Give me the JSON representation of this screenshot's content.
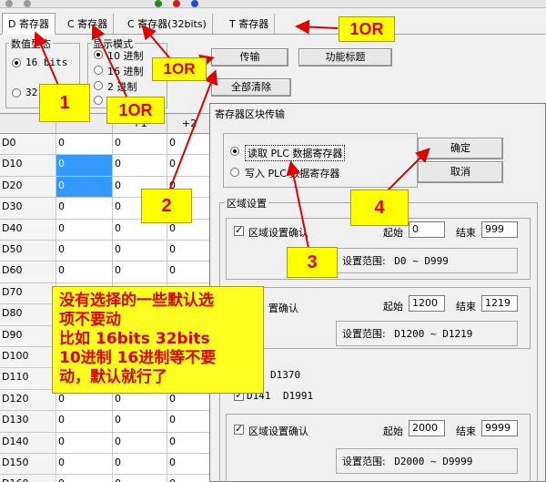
{
  "tabs": [
    {
      "label": "D 寄存器",
      "active": true
    },
    {
      "label": "C 寄存器",
      "active": false
    },
    {
      "label": "C 寄存器(32bits)",
      "active": false
    },
    {
      "label": "T 寄存器",
      "active": false
    }
  ],
  "data_format": {
    "title": "数值型态",
    "options": [
      "16 bits",
      "32"
    ]
  },
  "display_mode": {
    "title": "显示模式",
    "options": [
      "10 进制",
      "16 进制",
      "2 进制"
    ]
  },
  "buttons": {
    "transfer": "传输",
    "function_title": "功能标题",
    "clear_all": "全部清除"
  },
  "grid": {
    "col_header_plus1": "+1",
    "col_header_plus2": "+2",
    "rows": [
      "D0",
      "D10",
      "D20",
      "D30",
      "D40",
      "D50",
      "D60",
      "D70",
      "D80",
      "D90",
      "D100",
      "D110",
      "D120",
      "D130",
      "D140",
      "D150",
      "D160"
    ],
    "cell_value": "0"
  },
  "dialog": {
    "title": "寄存器区块传输",
    "read_option": "读取 PLC 数据寄存器",
    "write_option": "写入 PLC 数据寄存器",
    "ok": "确定",
    "cancel": "取消",
    "region_title": "区域设置",
    "enable_label": "区域设置确认",
    "start_label": "起始",
    "end_label": "结束",
    "range_label": "设置范围:",
    "regions": [
      {
        "start": "0",
        "end": "999",
        "range": "D0 ~ D999"
      },
      {
        "start": "1200",
        "end": "1219",
        "range": "D1200 ~ D1219"
      },
      {
        "start": "",
        "end": "",
        "range": "D1370"
      },
      {
        "start": "",
        "end": "",
        "range": "D1991"
      },
      {
        "start": "2000",
        "end": "9999",
        "range": "D2000 ~ D9999"
      }
    ],
    "region_partial_prefix": "置确认",
    "d14_partial": "D141"
  },
  "annotations": {
    "one_or_top": "1OR",
    "one_or_mid": "1OR",
    "one_or_left": "1OR",
    "n1": "1",
    "n2": "2",
    "n3": "3",
    "n4": "4",
    "callout_lines": [
      "没有选择的一些默认选",
      "项不要动",
      "比如 16bits 32bits",
      "10进制 16进制等不要",
      "动，默认就行了"
    ]
  },
  "colors": {
    "annotation_bg": "#ffff00",
    "annotation_text": "#e00000",
    "arrow": "#e00000",
    "selection": "#3399ff"
  }
}
